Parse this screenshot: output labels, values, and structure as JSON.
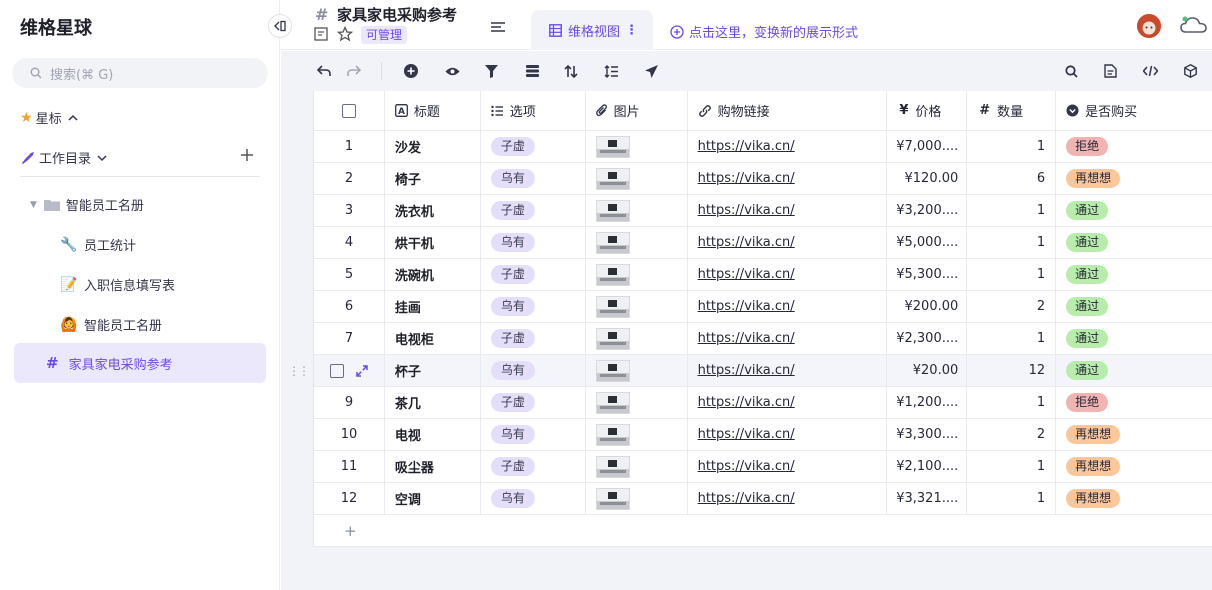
{
  "sidebar": {
    "space_name": "维格星球",
    "search_placeholder": "搜索(⌘ G)",
    "favorites_label": "星标",
    "workdir_label": "工作目录",
    "folder": "智能员工名册",
    "items": [
      {
        "label": "员工统计",
        "emoji": "🔧"
      },
      {
        "label": "入职信息填写表",
        "emoji": "📝"
      },
      {
        "label": "智能员工名册",
        "emoji": "🙆"
      },
      {
        "label": "家具家电采购参考",
        "emoji": "#"
      }
    ]
  },
  "header": {
    "title": "家具家电采购参考",
    "permission": "可管理",
    "view_name": "维格视图",
    "add_view": "点击这里，变换新的展示形式"
  },
  "columns": {
    "title": "标题",
    "option": "选项",
    "image": "图片",
    "link": "购物链接",
    "price": "价格",
    "qty": "数量",
    "buy": "是否购买"
  },
  "rows": [
    {
      "idx": "1",
      "title": "沙发",
      "option": "子虚",
      "link": "https://vika.cn/",
      "price": "¥7,000....",
      "qty": "1",
      "buy": "拒绝"
    },
    {
      "idx": "2",
      "title": "椅子",
      "option": "乌有",
      "link": "https://vika.cn/",
      "price": "¥120.00",
      "qty": "6",
      "buy": "再想想"
    },
    {
      "idx": "3",
      "title": "洗衣机",
      "option": "子虚",
      "link": "https://vika.cn/",
      "price": "¥3,200....",
      "qty": "1",
      "buy": "通过"
    },
    {
      "idx": "4",
      "title": "烘干机",
      "option": "乌有",
      "link": "https://vika.cn/",
      "price": "¥5,000....",
      "qty": "1",
      "buy": "通过"
    },
    {
      "idx": "5",
      "title": "洗碗机",
      "option": "子虚",
      "link": "https://vika.cn/",
      "price": "¥5,300....",
      "qty": "1",
      "buy": "通过"
    },
    {
      "idx": "6",
      "title": "挂画",
      "option": "乌有",
      "link": "https://vika.cn/",
      "price": "¥200.00",
      "qty": "2",
      "buy": "通过"
    },
    {
      "idx": "7",
      "title": "电视柜",
      "option": "子虚",
      "link": "https://vika.cn/",
      "price": "¥2,300....",
      "qty": "1",
      "buy": "通过"
    },
    {
      "idx": "",
      "title": "杯子",
      "option": "乌有",
      "link": "https://vika.cn/",
      "price": "¥20.00",
      "qty": "12",
      "buy": "通过"
    },
    {
      "idx": "9",
      "title": "茶几",
      "option": "子虚",
      "link": "https://vika.cn/",
      "price": "¥1,200....",
      "qty": "1",
      "buy": "拒绝"
    },
    {
      "idx": "10",
      "title": "电视",
      "option": "乌有",
      "link": "https://vika.cn/",
      "price": "¥3,300....",
      "qty": "2",
      "buy": "再想想"
    },
    {
      "idx": "11",
      "title": "吸尘器",
      "option": "子虚",
      "link": "https://vika.cn/",
      "price": "¥2,100....",
      "qty": "1",
      "buy": "再想想"
    },
    {
      "idx": "12",
      "title": "空调",
      "option": "乌有",
      "link": "https://vika.cn/",
      "price": "¥3,321....",
      "qty": "1",
      "buy": "再想想"
    }
  ],
  "status_colors": {
    "拒绝": "#f2b3b3",
    "再想想": "#fbc79a",
    "通过": "#b8ecab"
  },
  "add_row_label": "+",
  "colors": {
    "accent": "#6b4be0",
    "active_bg": "#ece8fb",
    "toolbar_bg": "#f2f3f8"
  }
}
